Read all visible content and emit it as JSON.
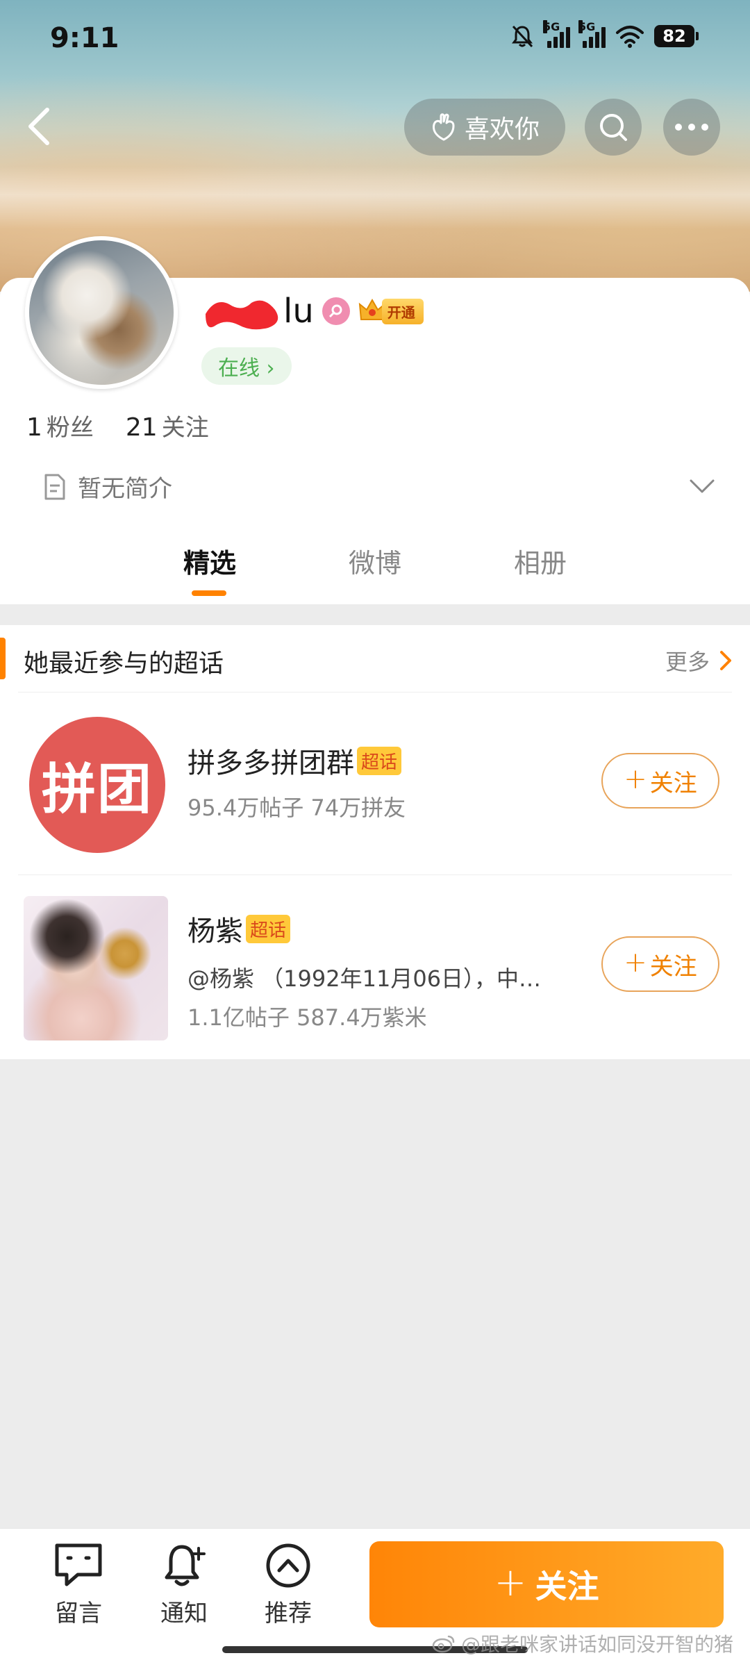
{
  "status_bar": {
    "time": "9:11",
    "network_1": "5G",
    "network_2": "5G",
    "battery": "82"
  },
  "nav": {
    "like_label": "喜欢你"
  },
  "profile": {
    "name_visible": "lu",
    "vip_label": "开通",
    "online": "在线 ›",
    "fans_count": "1",
    "fans_label": "粉丝",
    "following_count": "21",
    "following_label": "关注",
    "bio": "暂无简介"
  },
  "tabs": [
    {
      "label": "精选",
      "active": true
    },
    {
      "label": "微博",
      "active": false
    },
    {
      "label": "相册",
      "active": false
    }
  ],
  "super_topics": {
    "title": "她最近参与的超话",
    "more": "更多",
    "items": [
      {
        "thumb_text": "拼团",
        "name": "拼多多拼团群",
        "tag": "超话",
        "desc": "95.4万帖子 74万拼友",
        "follow": "关注"
      },
      {
        "name": "杨紫",
        "tag": "超话",
        "desc1": "@杨紫 （1992年11月06日），中…",
        "desc2": "1.1亿帖子 587.4万紫米",
        "follow": "关注"
      }
    ]
  },
  "bottom_bar": {
    "message": "留言",
    "notify": "通知",
    "recommend": "推荐",
    "follow": "关注"
  },
  "watermark": "@跟老咪家讲话如同没开智的猪",
  "colors": {
    "accent": "#ff8200",
    "online_green": "#4caf50",
    "pt_red": "#e25a56"
  }
}
